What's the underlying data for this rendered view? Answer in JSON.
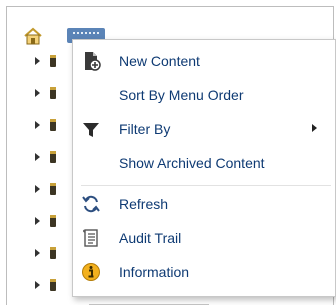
{
  "tree": {
    "rows": 8
  },
  "context_menu": {
    "items": [
      {
        "label": "New Content",
        "icon": "new-content-icon"
      },
      {
        "label": "Sort By Menu Order",
        "icon": ""
      },
      {
        "label": "Filter By",
        "icon": "filter-icon",
        "submenu": true
      },
      {
        "label": "Show Archived Content",
        "icon": ""
      },
      {
        "label": "Refresh",
        "icon": "refresh-icon"
      },
      {
        "label": "Audit Trail",
        "icon": "audit-trail-icon"
      },
      {
        "label": "Information",
        "icon": "information-icon"
      }
    ]
  },
  "colors": {
    "menu_text": "#0e3a73",
    "selected_node": "#5b84b7"
  }
}
